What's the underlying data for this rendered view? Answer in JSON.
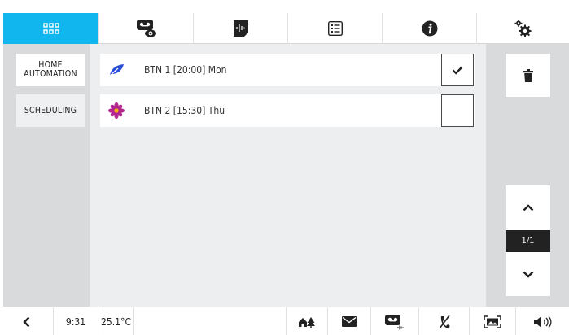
{
  "top_tabs": [
    {
      "name": "apps-grid-icon",
      "active": true
    },
    {
      "name": "voicemail-view-icon",
      "active": false
    },
    {
      "name": "audio-message-icon",
      "active": false
    },
    {
      "name": "list-icon",
      "active": false
    },
    {
      "name": "info-icon",
      "active": false
    },
    {
      "name": "settings-gears-icon",
      "active": false
    }
  ],
  "left_nav": {
    "home_automation_line1": "HOME",
    "home_automation_line2": "AUTOMATION",
    "scheduling": "SCHEDULING"
  },
  "schedules": [
    {
      "label": "BTN 1 [20:00] Mon",
      "icon": "leaf-icon",
      "checked": true
    },
    {
      "label": "BTN 2 [15:30] Thu",
      "icon": "flower-icon",
      "checked": false
    }
  ],
  "pagination": {
    "indicator": "1/1"
  },
  "status_bar": {
    "time": "9:31",
    "temperature": "25.1°C"
  },
  "colors": {
    "accent": "#12b6ee",
    "leaf": "#2a4fd6",
    "flower": "#b3268f",
    "panel": "#d8dadb",
    "main": "#eceeef"
  }
}
